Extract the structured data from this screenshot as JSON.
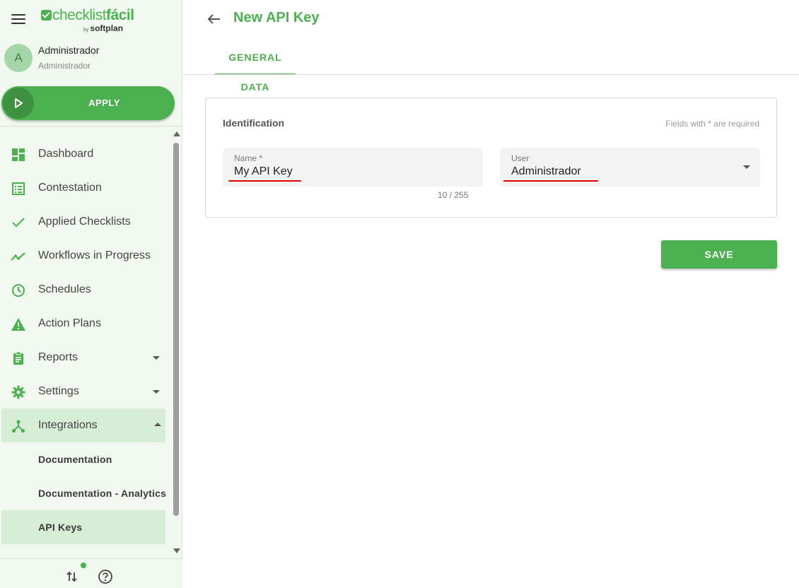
{
  "app": {
    "logo_text_light": "checklist",
    "logo_text_bold": "fácil",
    "logo_by": "by",
    "logo_company": "softplan"
  },
  "user": {
    "avatar_letter": "A",
    "name": "Administrador",
    "role": "Administrador"
  },
  "apply_button": {
    "label": "APPLY"
  },
  "sidebar": {
    "items": [
      {
        "label": "Dashboard",
        "icon": "dashboard-icon"
      },
      {
        "label": "Contestation",
        "icon": "list-icon"
      },
      {
        "label": "Applied Checklists",
        "icon": "check-icon"
      },
      {
        "label": "Workflows in Progress",
        "icon": "trending-icon"
      },
      {
        "label": "Schedules",
        "icon": "clock-icon"
      },
      {
        "label": "Action Plans",
        "icon": "warning-icon"
      },
      {
        "label": "Reports",
        "icon": "clipboard-icon",
        "expandable": true
      },
      {
        "label": "Settings",
        "icon": "gear-icon",
        "expandable": true
      },
      {
        "label": "Integrations",
        "icon": "integrations-icon",
        "expanded": true,
        "active": true
      }
    ],
    "sub_items": [
      {
        "label": "Documentation"
      },
      {
        "label": "Documentation - Analytics"
      },
      {
        "label": "API Keys",
        "active": true
      }
    ]
  },
  "header": {
    "title": "New API Key",
    "tabs": [
      {
        "label": "GENERAL DATA",
        "active": true
      }
    ]
  },
  "form": {
    "section_title": "Identification",
    "required_note": "Fields with * are required",
    "name_field": {
      "label": "Name *",
      "value": "My API Key",
      "counter": "10 / 255"
    },
    "user_field": {
      "label": "User",
      "value": "Administrador"
    },
    "save_label": "SAVE"
  },
  "colors": {
    "accent": "#4caf50",
    "sidebar_bg": "#f1f8ef",
    "active_bg": "#d8edd6",
    "highlight_underline": "#e00000"
  }
}
